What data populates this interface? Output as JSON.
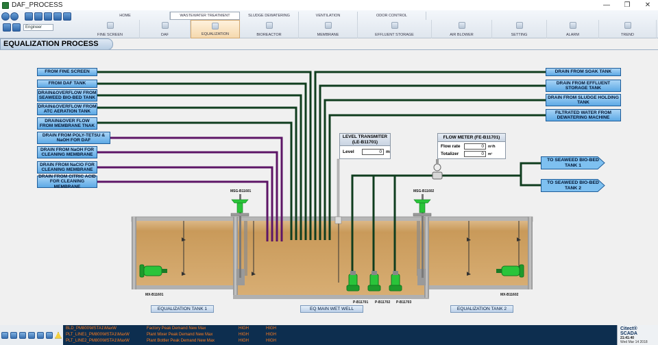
{
  "window": {
    "title": "DAF_PROCESS"
  },
  "toolbar": {
    "user_field": "Engineer",
    "menu_top": [
      {
        "label": "HOME",
        "active": false
      },
      {
        "label": "WASTEWATER TREATMENT",
        "active": true
      },
      {
        "label": "SLUDGE DEWATERING",
        "active": false
      },
      {
        "label": "VENTILATION",
        "active": false
      },
      {
        "label": "ODOR CONTROL",
        "active": false
      }
    ],
    "menu_sub": [
      {
        "label": "FINE SCREEN",
        "active": false
      },
      {
        "label": "DAF",
        "active": false
      },
      {
        "label": "EQUALIZATION",
        "active": true
      },
      {
        "label": "BIOREACTOR",
        "active": false
      },
      {
        "label": "MEMBRANE",
        "active": false
      },
      {
        "label": "EFFLUENT STORAGE",
        "active": false
      },
      {
        "label": "AIR BLOWER",
        "active": false
      },
      {
        "label": "SETTING",
        "active": false
      },
      {
        "label": "ALARM",
        "active": false
      },
      {
        "label": "TREND",
        "active": false
      }
    ]
  },
  "page": {
    "title": "EQUALIZATION PROCESS"
  },
  "inputs_left": [
    "FROM FINE SCREEN",
    "FROM DAF TANK",
    "DRAIN&OVERFLOW FROM SEAWEED BIO-BED TANK",
    "DRAIN&OVERFLOW FROM ATC AERATION TANK",
    "DRAIN&OVER FLOW  FROM MEMBRANE TNAK",
    "DRAIN FROM POLY-TETSU & NaOH FOR DAF",
    "DRAIN FROM NaOH FOR CLEANING MEMBRANE",
    "DRAIN FROM NaClO FOR CLEANING MEMBRANE",
    "DRAIN FROM CITRIC ACID FOR CLEANING MEMBRANE"
  ],
  "inputs_right": [
    "DRAIN FROM SOAK TANK",
    "DRAIN FROM EFFLUENT STORAGE TANK",
    "DRAIN FROM SLUDGE HOLDING TANK",
    "FILTRATED WATER FROM DEWATERING MACHINE"
  ],
  "outputs": [
    "TO SEAWEED BIO-BED TANK 1",
    "TO SEAWEED BIO-BED TANK 2"
  ],
  "level_transmitter": {
    "title": "LEVEL TRANSMITER (LE-B11701)",
    "level_label": "Level",
    "level_value": "0",
    "level_unit": "m"
  },
  "flow_meter": {
    "title": "FLOW METER (FE-B11701)",
    "rate_label": "Flow rate",
    "rate_value": "0",
    "rate_unit": "m³/h",
    "total_label": "Totalizer",
    "total_value": "0",
    "total_unit": "m³"
  },
  "equipment": {
    "mixer1": "MSG-B11601",
    "mixer2": "MSG-B11602",
    "mx1": "MX-B11601",
    "mx2": "MX-B11602",
    "pump1": "P-B11701",
    "pump2": "P-B11702",
    "pump3": "P-B11703"
  },
  "tanks": {
    "tank1": "EQUALIZATION TANK 1",
    "wet_well": "EQ MAIN WET WELL",
    "tank2": "EQUALIZATION TANK 2"
  },
  "alarms": [
    {
      "tag": "BLD_PM800\\MSTA1\\MaxW",
      "desc": "Factory Peak Demand New Max",
      "prio": "HIGH",
      "state": "HIGH"
    },
    {
      "tag": "PLT_LINE1_PM800\\MSTA1\\MaxW",
      "desc": "Plant Mixer Peak Demand New Max",
      "prio": "HIGH",
      "state": "HIGH"
    },
    {
      "tag": "PLT_LINE2_PM800\\MSTA1\\MaxW",
      "desc": "Plant Bottler Peak Demand New Max",
      "prio": "HIGH",
      "state": "HIGH"
    }
  ],
  "status": {
    "brand": "Citect® SCADA",
    "time": "21:41:40",
    "date": "Wed Mar 14 2018"
  },
  "colors": {
    "pipe_green": "#0f3d1e",
    "pipe_purple": "#5d1566",
    "sludge": "#c99a5a",
    "accent_blue": "#5da9e5",
    "alarm_text": "#ff7d1f"
  }
}
